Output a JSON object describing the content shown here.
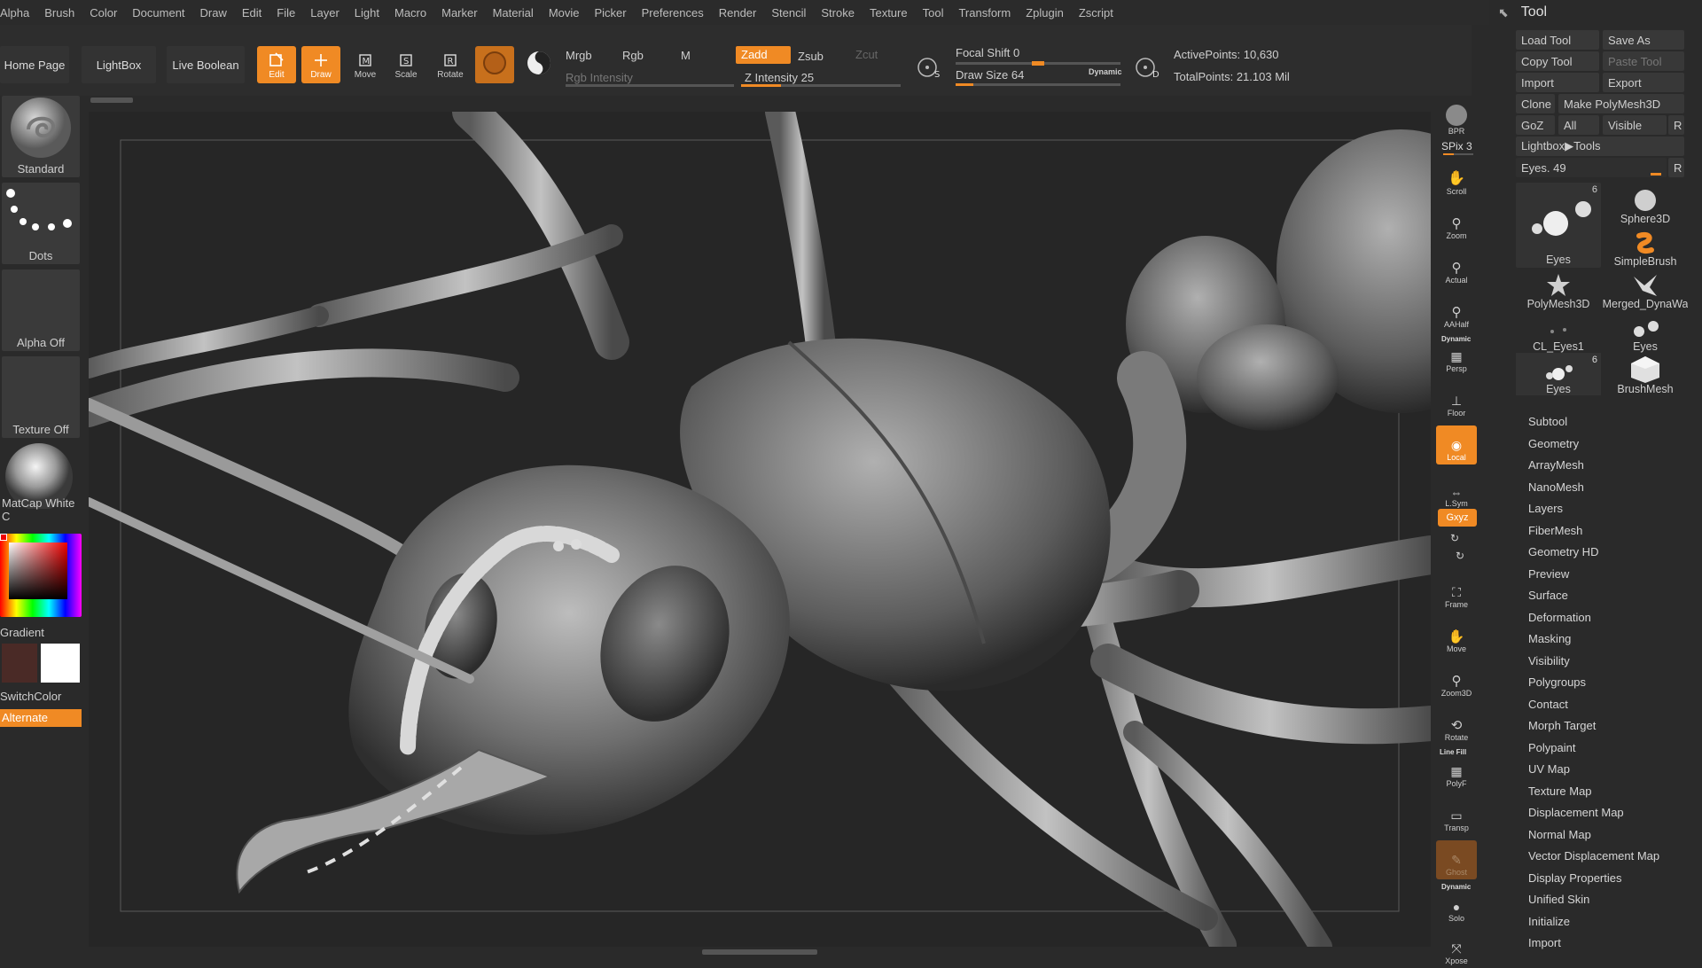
{
  "menu": [
    "Alpha",
    "Brush",
    "Color",
    "Document",
    "Draw",
    "Edit",
    "File",
    "Layer",
    "Light",
    "Macro",
    "Marker",
    "Material",
    "Movie",
    "Picker",
    "Preferences",
    "Render",
    "Stencil",
    "Stroke",
    "Texture",
    "Tool",
    "Transform",
    "Zplugin",
    "Zscript"
  ],
  "toolbar": {
    "home_page": "Home Page",
    "lightbox": "LightBox",
    "live_boolean": "Live Boolean",
    "edit": "Edit",
    "draw": "Draw",
    "move": "Move",
    "scale": "Scale",
    "rotate": "Rotate",
    "mrgb": "Mrgb",
    "rgb": "Rgb",
    "m": "M",
    "rgb_intensity": "Rgb Intensity",
    "zadd": "Zadd",
    "zsub": "Zsub",
    "zcut": "Zcut",
    "z_intensity_label": "Z Intensity",
    "z_intensity": "25",
    "z_intensity_level": 0.25,
    "focal_shift_label": "Focal Shift",
    "focal_shift": "0",
    "focal_shift_level": 0.5,
    "draw_size_label": "Draw Size",
    "draw_size": "64",
    "draw_size_level": 0.06,
    "dynamic": "Dynamic",
    "active_points": "ActivePoints: 10,630",
    "total_points": "TotalPoints: 21.103 Mil"
  },
  "left_shelf": {
    "brush": "Standard",
    "stroke": "Dots",
    "alpha": "Alpha Off",
    "texture": "Texture Off",
    "material": "MatCap White C",
    "gradient": "Gradient",
    "switch_color": "SwitchColor",
    "alternate": "Alternate"
  },
  "right_shelf": {
    "bpr": "BPR",
    "spix": "SPix 3",
    "scroll": "Scroll",
    "zoom": "Zoom",
    "actual": "Actual",
    "aahalf": "AAHalf",
    "dynamic": "Dynamic",
    "persp": "Persp",
    "floor": "Floor",
    "local": "Local",
    "lsym": "L.Sym",
    "xyz": "Gxyz",
    "frame": "Frame",
    "move": "Move",
    "zoom3d": "Zoom3D",
    "rotate": "Rotate",
    "line_fill": "Line Fill",
    "polyf": "PolyF",
    "transp": "Transp",
    "ghost": "Ghost",
    "dynamic2": "Dynamic",
    "solo": "Solo",
    "xpose": "Xpose"
  },
  "tool_panel": {
    "title": "Tool",
    "load_tool": "Load Tool",
    "save_as": "Save As",
    "copy_tool": "Copy Tool",
    "paste_tool": "Paste Tool",
    "import": "Import",
    "export": "Export",
    "clone": "Clone",
    "make_polymesh": "Make PolyMesh3D",
    "goz": "GoZ",
    "all": "All",
    "visible": "Visible",
    "r": "R",
    "lightbox_tools": "Lightbox▶Tools",
    "eyes_slider_label": "Eyes.",
    "eyes_slider": "49",
    "eyes_level": 0.95,
    "tools": [
      {
        "name": "Eyes",
        "count": "6"
      },
      {
        "name": "Sphere3D",
        "count": ""
      },
      {
        "name": "SimpleBrush",
        "count": ""
      },
      {
        "name": "PolyMesh3D",
        "count": ""
      },
      {
        "name": "Merged_DynaWa",
        "count": ""
      },
      {
        "name": "CL_Eyes1",
        "count": ""
      },
      {
        "name": "Eyes",
        "count": ""
      },
      {
        "name": "Eyes",
        "count": "6"
      },
      {
        "name": "BrushMesh",
        "count": ""
      }
    ],
    "subpalettes": [
      "Subtool",
      "Geometry",
      "ArrayMesh",
      "NanoMesh",
      "Layers",
      "FiberMesh",
      "Geometry HD",
      "Preview",
      "Surface",
      "Deformation",
      "Masking",
      "Visibility",
      "Polygroups",
      "Contact",
      "Morph Target",
      "Polypaint",
      "UV Map",
      "Texture Map",
      "Displacement Map",
      "Normal Map",
      "Vector Displacement Map",
      "Display Properties",
      "Unified Skin",
      "Initialize",
      "Import"
    ]
  },
  "colors": {
    "accent": "#f08a24",
    "panel": "#2a2a2a",
    "button": "#383838"
  }
}
